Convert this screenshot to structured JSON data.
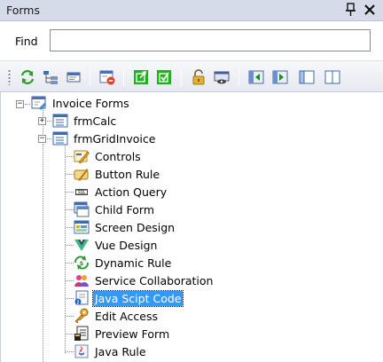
{
  "panel": {
    "title": "Forms",
    "pin_icon": "pin-icon",
    "close_icon": "close-icon"
  },
  "find": {
    "label": "Find",
    "value": "",
    "placeholder": ""
  },
  "toolbar": {
    "buttons": [
      {
        "name": "refresh-icon"
      },
      {
        "name": "tree-view-icon"
      },
      {
        "name": "properties-icon"
      },
      {
        "name": "form-delete-icon"
      },
      {
        "name": "green-export-icon"
      },
      {
        "name": "green-check-icon"
      },
      {
        "name": "lock-icon"
      },
      {
        "name": "screen-view-icon"
      },
      {
        "name": "nav-left-icon"
      },
      {
        "name": "nav-right-icon"
      },
      {
        "name": "split-left-icon"
      },
      {
        "name": "split-columns-icon"
      }
    ]
  },
  "tree": {
    "root": "Invoice Forms",
    "forms": [
      "frmCalc",
      "frmGridInvoice"
    ],
    "items": [
      "Controls",
      "Button Rule",
      "Action Query",
      "Child Form",
      "Screen Design",
      "Vue Design",
      "Dynamic Rule",
      "Service Collaboration",
      "Java Scipt Code",
      "Edit Access",
      "Preview Form",
      "Java Rule"
    ],
    "selected": "Java Scipt Code"
  }
}
